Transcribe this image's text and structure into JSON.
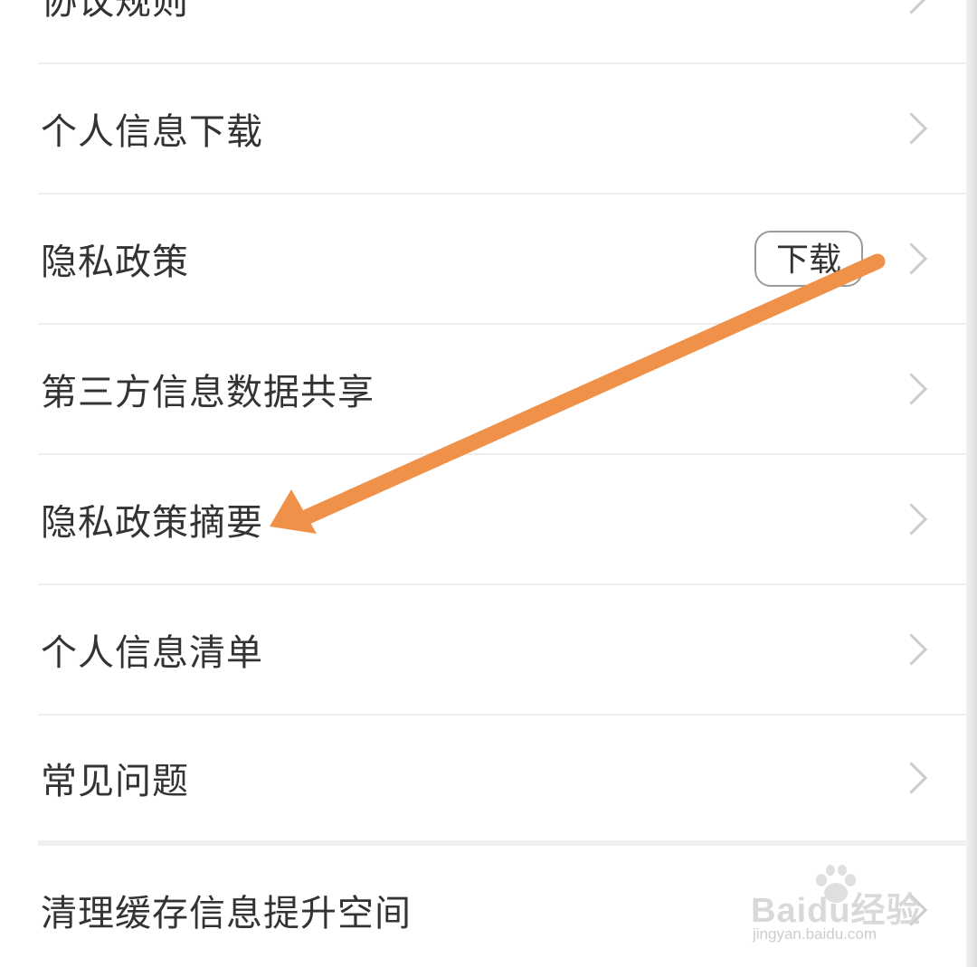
{
  "menu": {
    "items": [
      {
        "label": "协议规则"
      },
      {
        "label": "个人信息下载"
      },
      {
        "label": "隐私政策",
        "badge": "下载"
      },
      {
        "label": "第三方信息数据共享"
      },
      {
        "label": "隐私政策摘要"
      },
      {
        "label": "个人信息清单"
      },
      {
        "label": "常见问题"
      },
      {
        "label": "清理缓存信息提升空间"
      }
    ]
  },
  "annotation": {
    "arrow_color": "#F0914A",
    "points_to": "隐私政策摘要"
  },
  "watermark": {
    "brand": "Baidu经验",
    "url": "jingyan.baidu.com"
  }
}
